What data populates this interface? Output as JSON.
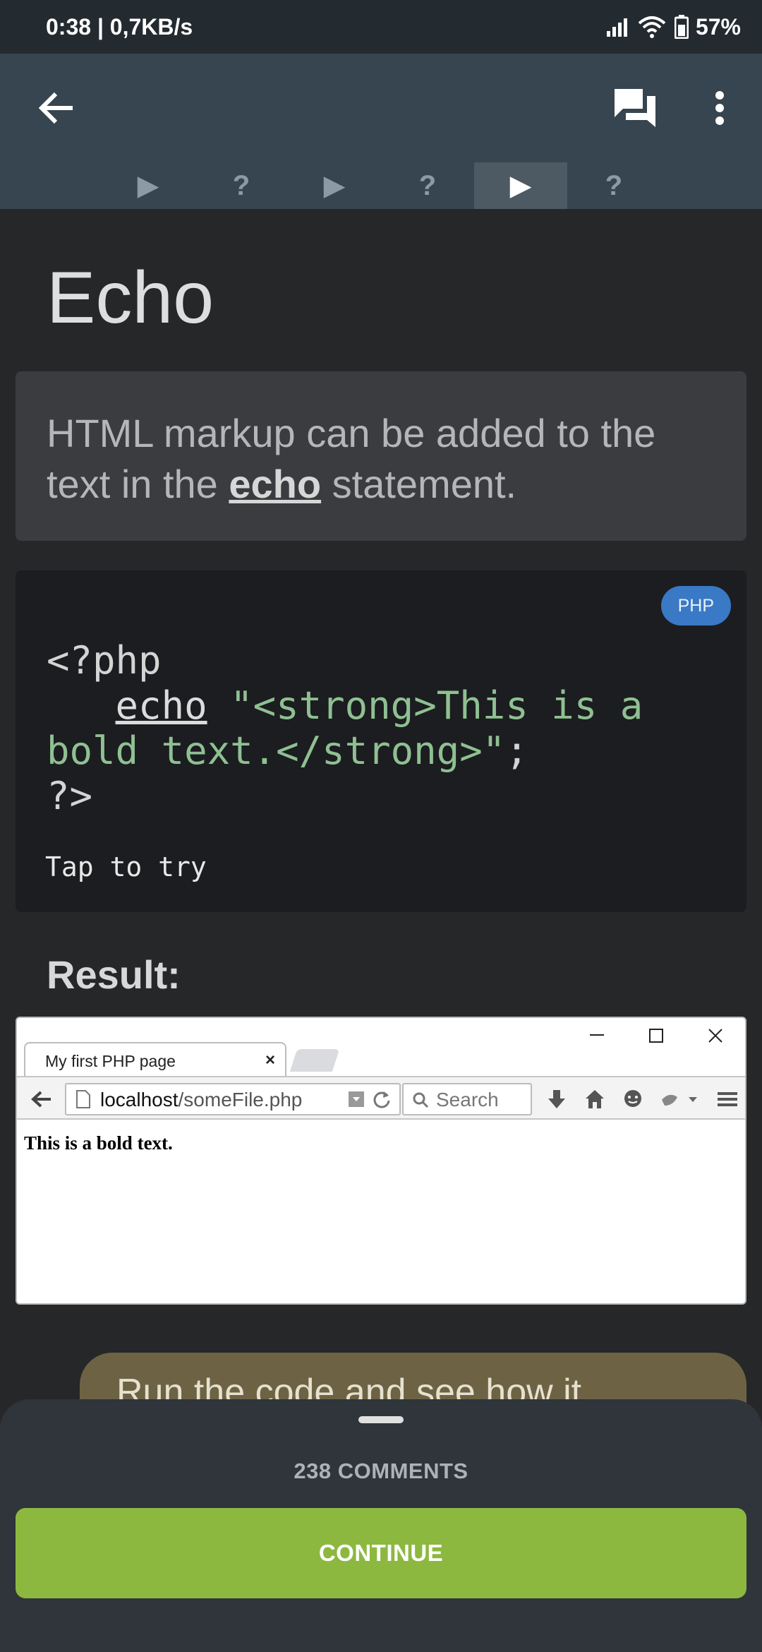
{
  "status_bar": {
    "time": "0:38",
    "speed": "0,7KB/s",
    "battery": "57%"
  },
  "app_bar": {
    "back_icon": "arrow-left-icon",
    "comments_icon": "chat-bubbles-icon",
    "menu_icon": "more-vert-icon"
  },
  "steps": [
    {
      "label": "▶",
      "kind": "lesson"
    },
    {
      "label": "?",
      "kind": "quiz"
    },
    {
      "label": "▶",
      "kind": "lesson"
    },
    {
      "label": "?",
      "kind": "quiz"
    },
    {
      "label": "▶",
      "kind": "lesson",
      "active": true
    },
    {
      "label": "?",
      "kind": "quiz"
    }
  ],
  "lesson": {
    "title": "Echo",
    "info_before": "HTML markup can be added to the text in the ",
    "info_keyword": "echo",
    "info_after": " statement.",
    "code_language": "PHP",
    "code": {
      "open_tag": "<?php",
      "indent": "   ",
      "fn": "echo",
      "space": " ",
      "string_1": "\"<strong>This is a",
      "string_2": "bold text.</strong>\"",
      "semicolon": ";",
      "close_tag": "?>"
    },
    "tap_to_try": "Tap to try",
    "result_label": "Result:"
  },
  "browser": {
    "tab_title": "My first PHP page",
    "tab_close": "×",
    "url_host": "localhost",
    "url_path": "/someFile.php",
    "search_placeholder": "Search",
    "page_text": "This is a bold text."
  },
  "hint": {
    "text": "Run the code and see how it"
  },
  "sheet": {
    "comments_label": "238 COMMENTS",
    "continue_label": "CONTINUE"
  },
  "colors": {
    "continue": "#8cb83f",
    "php_badge": "#3979c6",
    "app_bar": "#36454f"
  }
}
